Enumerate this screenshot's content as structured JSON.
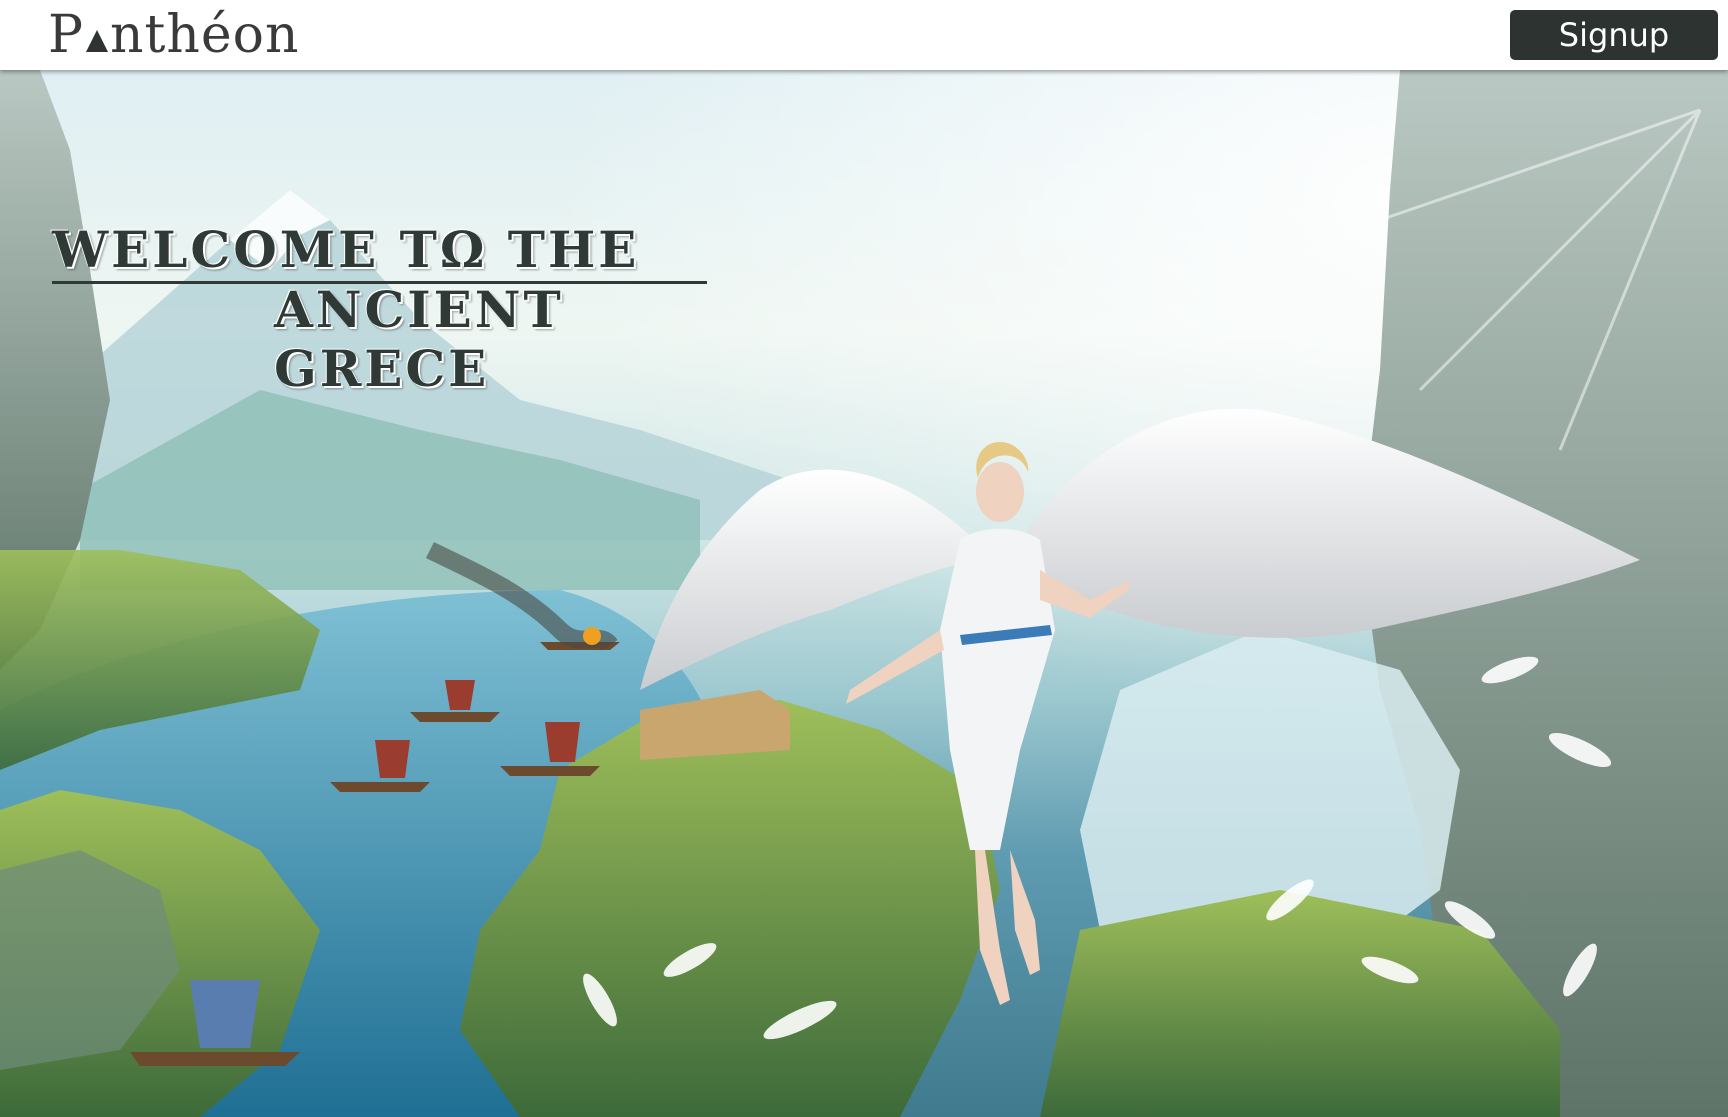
{
  "header": {
    "logo_text_start": "P",
    "logo_text_end": "nthéon",
    "signup_label": "Signup"
  },
  "hero": {
    "headline_line1": "WELCOME TΩ THE",
    "headline_line2": "ANCIENT GRECE"
  },
  "colors": {
    "button_bg": "#2d3331",
    "headline": "#2f3a37"
  },
  "icons": {
    "logo_mark": "triangle-icon"
  }
}
